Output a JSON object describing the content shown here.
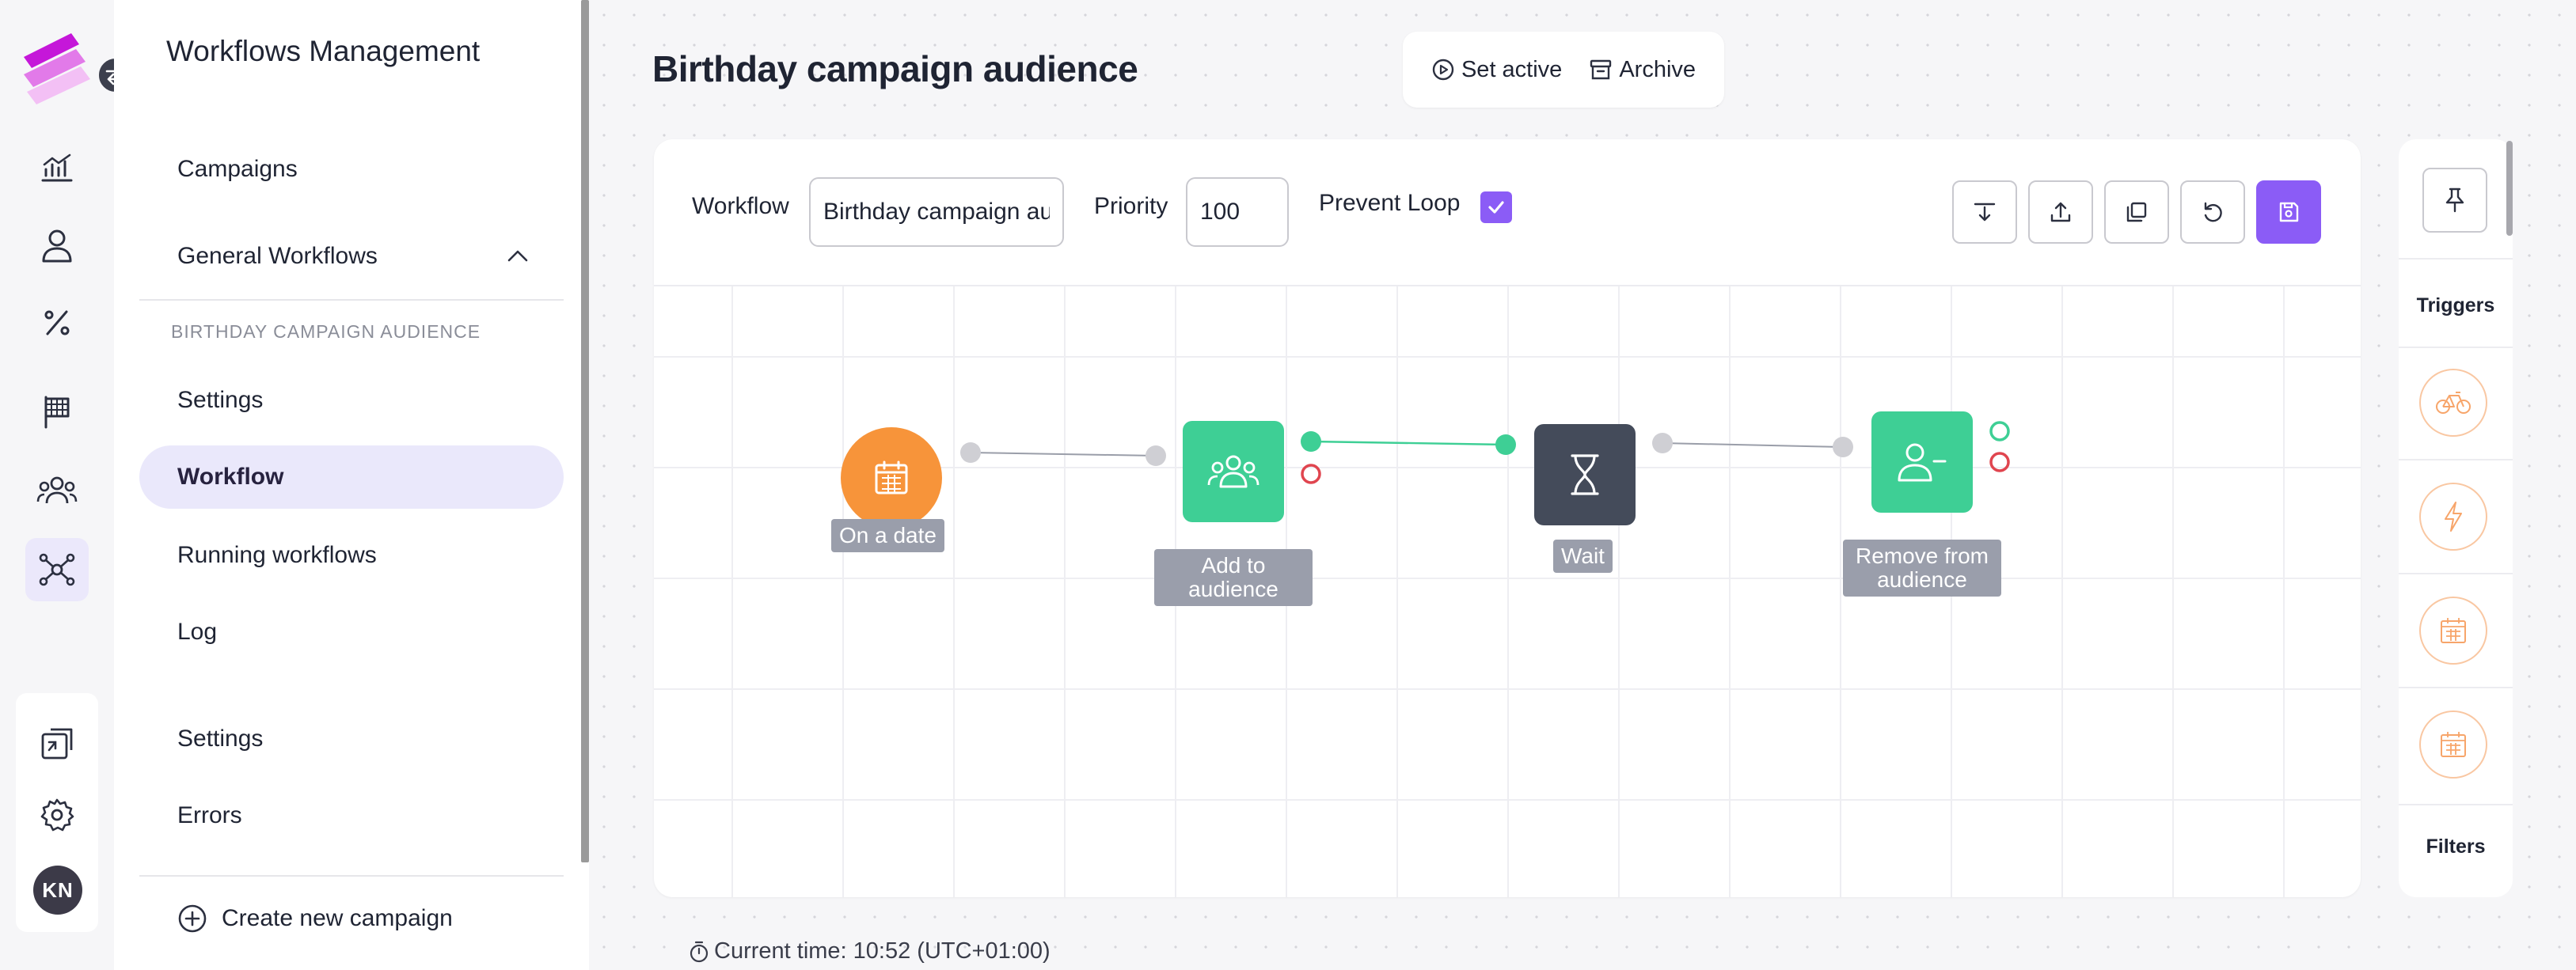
{
  "rail": {
    "avatar_initials": "KN",
    "items": [
      "analytics-icon",
      "user-icon",
      "percent-icon",
      "flag-icon",
      "users-icon",
      "workflow-icon"
    ],
    "bottom_items": [
      "puzzle-icon",
      "gear-icon"
    ]
  },
  "sidebar": {
    "title": "Workflows Management",
    "campaigns": "Campaigns",
    "general_workflows": "General Workflows",
    "section_label": "BIRTHDAY CAMPAIGN AUDIENCE",
    "items": {
      "settings": "Settings",
      "workflow": "Workflow",
      "running": "Running workflows",
      "log": "Log"
    },
    "global_settings": "Settings",
    "errors": "Errors",
    "create_campaign": "Create new campaign"
  },
  "header": {
    "title": "Birthday campaign audience",
    "set_active": "Set active",
    "archive": "Archive"
  },
  "toolbar": {
    "workflow_label": "Workflow",
    "workflow_value": "Birthday campaign audience",
    "priority_label": "Priority",
    "priority_value": "100",
    "prevent_loop_label": "Prevent Loop",
    "prevent_loop_checked": true,
    "buttons": [
      "import-icon",
      "export-icon",
      "duplicate-icon",
      "reset-icon",
      "save-icon"
    ]
  },
  "nodes": {
    "on_date": "On a date",
    "add_audience": "Add to\naudience",
    "wait": "Wait",
    "remove_audience": "Remove from\naudience"
  },
  "colors": {
    "accent": "#8b5cf6",
    "trigger_node": "#f7943a",
    "action_node": "#3ecf95",
    "wait_node": "#444b5a",
    "error_port": "#e0454f"
  },
  "right_panel": {
    "triggers_title": "Triggers",
    "filters_title": "Filters",
    "trigger_icons": [
      "bicycle-icon",
      "lightning-icon",
      "calendar-icon",
      "calendar-icon"
    ]
  },
  "footer": {
    "current_time": "Current time: 10:52 (UTC+01:00)"
  }
}
